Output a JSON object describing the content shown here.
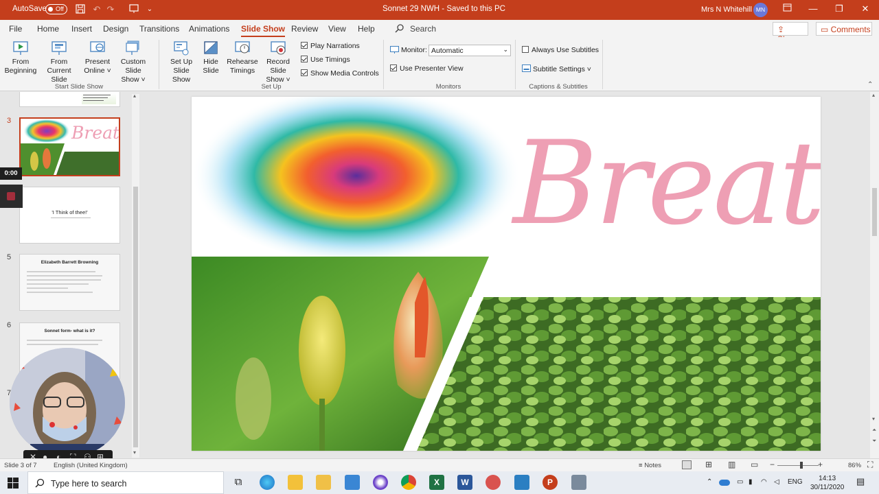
{
  "titlebar": {
    "autosave_label": "AutoSave",
    "autosave_state": "Off",
    "document_title": "Sonnet 29 NWH  -  Saved to this PC",
    "user_name": "Mrs N Whitehill",
    "user_initials": "MN"
  },
  "menu": {
    "tabs": [
      "File",
      "Home",
      "Insert",
      "Design",
      "Transitions",
      "Animations",
      "Slide Show",
      "Review",
      "View",
      "Help"
    ],
    "active": "Slide Show",
    "search_label": "Search",
    "share_label": "Share",
    "comments_label": "Comments"
  },
  "ribbon": {
    "start_group": {
      "label": "Start Slide Show",
      "from_beginning": [
        "From",
        "Beginning"
      ],
      "from_current": [
        "From",
        "Current Slide"
      ],
      "present_online": [
        "Present",
        "Online ˅"
      ],
      "custom_show": [
        "Custom Slide",
        "Show ˅"
      ]
    },
    "setup_group": {
      "label": "Set Up",
      "setup_show": [
        "Set Up",
        "Slide Show"
      ],
      "hide_slide": [
        "Hide",
        "Slide"
      ],
      "rehearse": [
        "Rehearse",
        "Timings"
      ],
      "record": [
        "Record Slide",
        "Show ˅"
      ],
      "play_narrations": "Play Narrations",
      "use_timings": "Use Timings",
      "show_media_controls": "Show Media Controls"
    },
    "monitors_group": {
      "label": "Monitors",
      "monitor_label": "Monitor:",
      "monitor_value": "Automatic",
      "presenter_view": "Use Presenter View"
    },
    "captions_group": {
      "label": "Captions & Subtitles",
      "always_subtitles": "Always Use Subtitles",
      "subtitle_settings": "Subtitle Settings ˅"
    }
  },
  "slides": {
    "numbers": [
      "3",
      "5",
      "6",
      "7"
    ],
    "slide3_word": "Breathe",
    "slide4_title": "'I Think of thee!'",
    "slide5_title": "Elizabeth Barrett Browning",
    "slide6_title": "Sonnet form- what is it?"
  },
  "recording": {
    "time": "0:00"
  },
  "main_slide": {
    "word": "Breathe"
  },
  "statusbar": {
    "slide_info": "Slide 3 of 7",
    "language": "English (United Kingdom)",
    "notes_label": "Notes",
    "zoom": "86%"
  },
  "taskbar": {
    "search_placeholder": "Type here to search",
    "lang": "ENG",
    "time": "14:13",
    "date": "30/11/2020"
  },
  "colors": {
    "accent": "#c43e1c",
    "breathe_pink": "#ee9fb4"
  }
}
